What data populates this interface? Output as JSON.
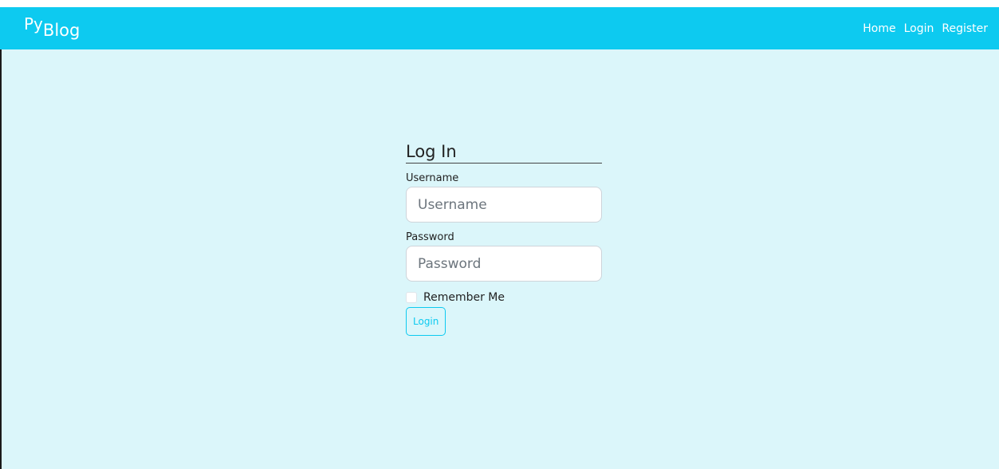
{
  "navbar": {
    "brand_py": "Py",
    "brand_blog": "Blog",
    "links": [
      "Home",
      "Login",
      "Register"
    ]
  },
  "form": {
    "title": "Log In",
    "username_label": "Username",
    "username_placeholder": "Username",
    "password_label": "Password",
    "password_placeholder": "Password",
    "remember_label": "Remember Me",
    "submit_label": "Login"
  },
  "colors": {
    "navbar": "#0dcaf0",
    "page_background": "#dbf6fa"
  }
}
